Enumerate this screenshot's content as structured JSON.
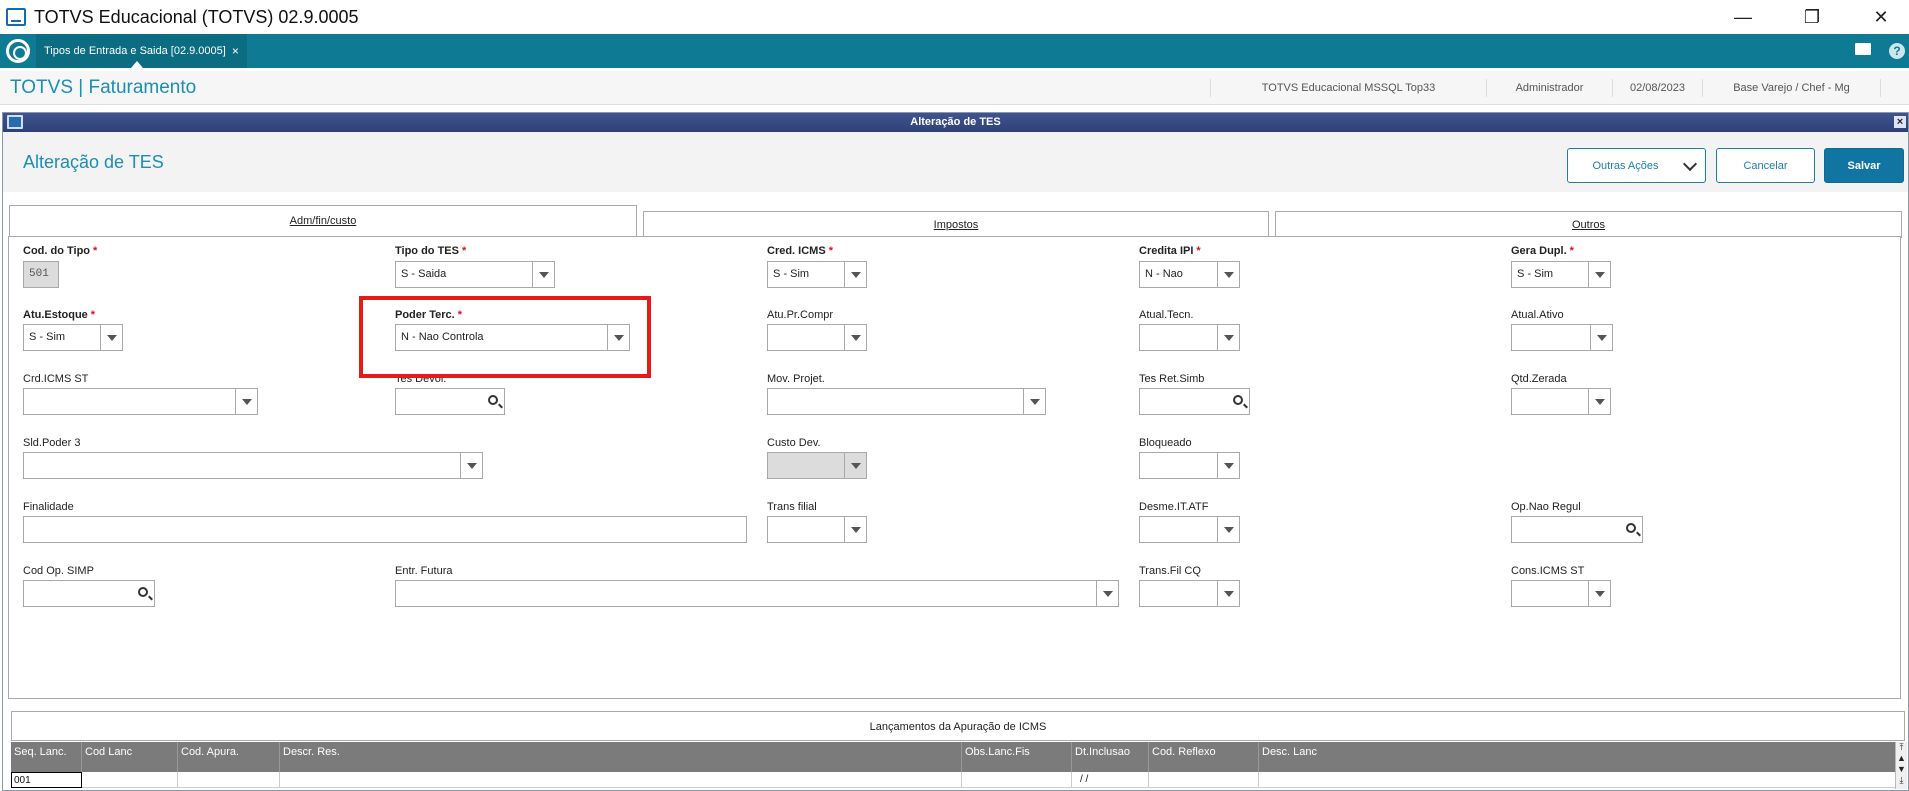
{
  "window": {
    "title": "TOTVS Educacional (TOTVS) 02.9.0005"
  },
  "tabbar": {
    "tab_label": "Tipos de Entrada e Saida [02.9.0005]",
    "tab_close": "×",
    "help": "?"
  },
  "module": {
    "title": "TOTVS | Faturamento",
    "environment": "TOTVS Educacional MSSQL Top33",
    "user": "Administrador",
    "date": "02/08/2023",
    "branch": "Base Varejo / Chef - Mg"
  },
  "dialog": {
    "window_title": "Alteração de TES",
    "close": "×",
    "title": "Alteração de TES",
    "buttons": {
      "other_actions": "Outras Ações",
      "cancel": "Cancelar",
      "save": "Salvar"
    },
    "tabs": [
      "Adm/fin/custo",
      "Impostos",
      "Outros"
    ]
  },
  "form": {
    "cod_tipo": {
      "label": "Cod. do Tipo",
      "value": "501"
    },
    "tipo_tes": {
      "label": "Tipo do TES",
      "value": "S - Saida"
    },
    "cred_icms": {
      "label": "Cred. ICMS",
      "value": "S - Sim"
    },
    "credita_ipi": {
      "label": "Credita IPI",
      "value": "N - Nao"
    },
    "gera_dupl": {
      "label": "Gera Dupl.",
      "value": "S - Sim"
    },
    "atu_estoque": {
      "label": "Atu.Estoque",
      "value": "S - Sim"
    },
    "poder_terc": {
      "label": "Poder Terc.",
      "value": "N - Nao Controla"
    },
    "atu_pr_compr": {
      "label": "Atu.Pr.Compr",
      "value": ""
    },
    "atual_tecn": {
      "label": "Atual.Tecn.",
      "value": ""
    },
    "atual_ativo": {
      "label": "Atual.Ativo",
      "value": ""
    },
    "crd_icms_st": {
      "label": "Crd.ICMS ST",
      "value": ""
    },
    "tes_devol": {
      "label": "Tes Devol.",
      "value": ""
    },
    "mov_projet": {
      "label": "Mov. Projet.",
      "value": ""
    },
    "tes_ret_simb": {
      "label": "Tes Ret.Simb",
      "value": ""
    },
    "qtd_zerada": {
      "label": "Qtd.Zerada",
      "value": ""
    },
    "sld_poder3": {
      "label": "Sld.Poder 3",
      "value": ""
    },
    "custo_dev": {
      "label": "Custo Dev.",
      "value": ""
    },
    "bloqueado": {
      "label": "Bloqueado",
      "value": ""
    },
    "finalidade": {
      "label": "Finalidade",
      "value": ""
    },
    "trans_filial": {
      "label": "Trans filial",
      "value": ""
    },
    "desme_it_atf": {
      "label": "Desme.IT.ATF",
      "value": ""
    },
    "op_nao_regul": {
      "label": "Op.Nao Regul",
      "value": ""
    },
    "cod_op_simp": {
      "label": "Cod Op. SIMP",
      "value": ""
    },
    "entr_futura": {
      "label": "Entr. Futura",
      "value": ""
    },
    "trans_fil_cq": {
      "label": "Trans.Fil CQ",
      "value": ""
    },
    "cons_icms_st": {
      "label": "Cons.ICMS ST",
      "value": ""
    }
  },
  "grid": {
    "section_title": "Lançamentos da Apuração de ICMS",
    "columns": [
      "Seq. Lanc.",
      "Cod Lanc",
      "Cod. Apura.",
      "Descr. Res.",
      "Obs.Lanc.Fis",
      "Dt.Inclusao",
      "Cod. Reflexo",
      "Desc. Lanc"
    ],
    "rows": [
      {
        "seq": "001",
        "dt": "/ /"
      }
    ]
  },
  "colors": {
    "accent": "#0e7a93",
    "title_blue": "#1b8fb3",
    "required": "#e01010",
    "highlight": "#e51b1b"
  }
}
